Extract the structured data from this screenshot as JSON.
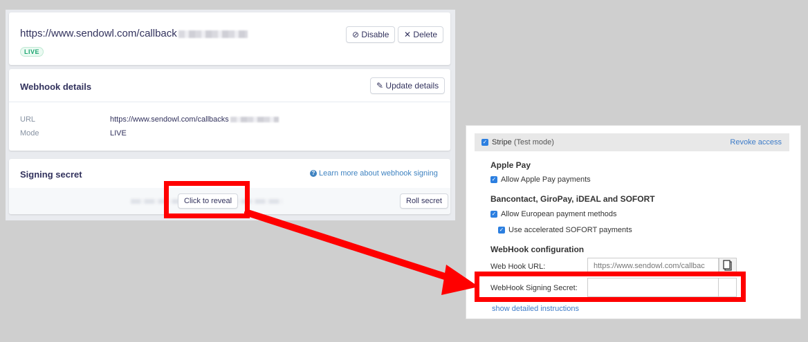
{
  "stripe_dashboard": {
    "endpoint_url": "https://www.sendowl.com/callback",
    "status_badge": "LIVE",
    "disable_label": "Disable",
    "delete_label": "Delete",
    "webhook_details": {
      "title": "Webhook details",
      "update_label": "Update details",
      "url_label": "URL",
      "url_value": "https://www.sendowl.com/callbacks",
      "mode_label": "Mode",
      "mode_value": "LIVE"
    },
    "signing_secret": {
      "title": "Signing secret",
      "learn_more": "Learn more about webhook signing",
      "reveal_label": "Click to reveal",
      "roll_label": "Roll secret"
    }
  },
  "sendowl_settings": {
    "stripe_label": "Stripe",
    "stripe_mode": "(Test mode)",
    "revoke_label": "Revoke access",
    "apple_pay_title": "Apple Pay",
    "allow_apple_pay": "Allow Apple Pay payments",
    "bancontact_title": "Bancontact, GiroPay, iDEAL and SOFORT",
    "allow_european": "Allow European payment methods",
    "use_sofort": "Use accelerated SOFORT payments",
    "webhook_title": "WebHook configuration",
    "webhook_url_label": "Web Hook URL:",
    "webhook_url_value": "https://www.sendowl.com/callbac",
    "signing_secret_label": "WebHook Signing Secret:",
    "show_instructions": "show detailed instructions"
  },
  "colors": {
    "highlight": "#ff0000",
    "link": "#3c7bc8",
    "live_badge": "#1ea672"
  },
  "icons": [
    "disable-icon",
    "close-icon",
    "pencil-icon",
    "info-icon",
    "checkbox-icon",
    "copy-icon",
    "arrow-annotation"
  ]
}
